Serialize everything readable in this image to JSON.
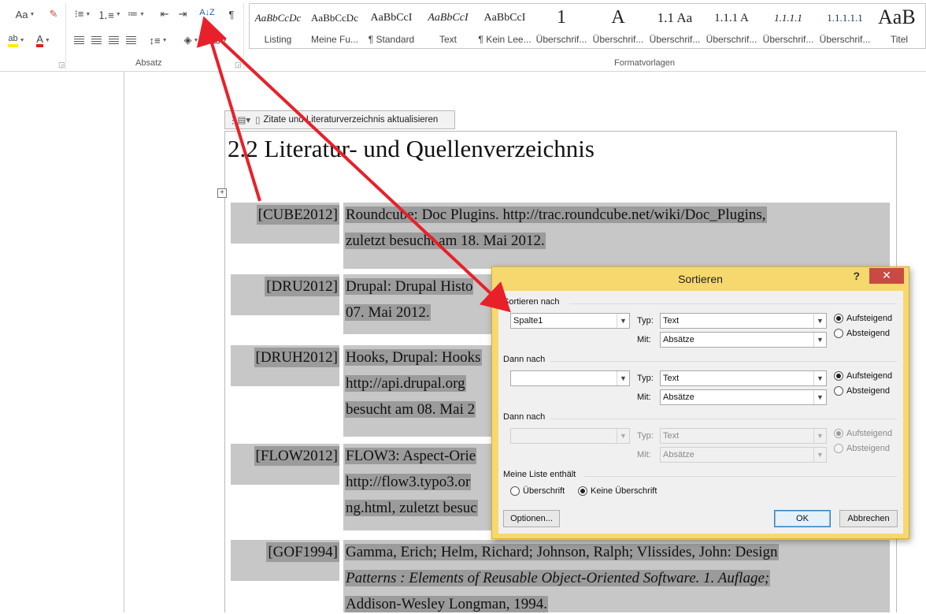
{
  "ribbon": {
    "font_size_button": "Aa",
    "sort_button_glyph": "A↓Z",
    "paragraph_marks_glyph": "¶",
    "group_paragraph_label": "Absatz",
    "group_styles_label": "Formatvorlagen",
    "styles": [
      {
        "sample": "AaBbCcDc",
        "name": "Listing"
      },
      {
        "sample": "AaBbCcDc",
        "name": "Meine Fu..."
      },
      {
        "sample": "AaBbCcI",
        "name": "¶ Standard"
      },
      {
        "sample": "AaBbCcI",
        "name": "Text"
      },
      {
        "sample": "AaBbCcI",
        "name": "¶ Kein Lee..."
      },
      {
        "sample": "1",
        "name": "Überschrif..."
      },
      {
        "sample": "A",
        "name": "Überschrif..."
      },
      {
        "sample": "1.1 Aa",
        "name": "Überschrif..."
      },
      {
        "sample": "1.1.1 A",
        "name": "Überschrif..."
      },
      {
        "sample": "1.1.1.1",
        "name": "Überschrif..."
      },
      {
        "sample": "1.1.1.1.1",
        "name": "Überschrif..."
      },
      {
        "sample": "1.1.1.1.1",
        "name": "Überschrif..."
      },
      {
        "sample": "AaB",
        "name": "Titel"
      }
    ]
  },
  "document": {
    "field_bar_label": "Zitate und Literaturverzeichnis aktualisieren",
    "heading": "2.2 Literatur- und Quellenverzeichnis",
    "references": [
      {
        "key": "[CUBE2012]",
        "lines": [
          "Roundcube: Doc Plugins. http://trac.roundcube.net/wiki/Doc_Plugins,",
          "zuletzt besucht am 18. Mai 2012."
        ]
      },
      {
        "key": "[DRU2012]",
        "lines": [
          "Drupal: Drupal Histo",
          "07. Mai 2012."
        ]
      },
      {
        "key": "[DRUH2012]",
        "lines": [
          "Hooks, Drupal: Hooks",
          "http://api.drupal.org",
          "besucht am 08. Mai 2"
        ]
      },
      {
        "key": "[FLOW2012]",
        "lines": [
          "FLOW3: Aspect-Orie",
          "http://flow3.typo3.or",
          "ng.html, zuletzt besuc"
        ]
      },
      {
        "key": "[GOF1994]",
        "lines": [
          "Gamma, Erich; Helm, Richard; Johnson, Ralph; Vlissides, John: Design",
          "Patterns : Elements of Reusable Object-Oriented Software. 1. Auflage;",
          "Addison-Wesley Longman, 1994."
        ]
      }
    ]
  },
  "dialog": {
    "title": "Sortieren",
    "help": "?",
    "close": "✕",
    "section1_title": "Sortieren nach",
    "section2_title": "Dann nach",
    "section3_title": "Dann nach",
    "type_label": "Typ:",
    "with_label": "Mit:",
    "row1": {
      "column": "Spalte1",
      "type": "Text",
      "with": "Absätze"
    },
    "row2": {
      "column": "",
      "type": "Text",
      "with": "Absätze"
    },
    "row3": {
      "column": "",
      "type": "Text",
      "with": "Absätze"
    },
    "ascending": "Aufsteigend",
    "descending": "Absteigend",
    "list_section_title": "Meine Liste enthält",
    "header_row": "Überschrift",
    "no_header_row": "Keine Überschrift",
    "options_button": "Optionen...",
    "ok_button": "OK",
    "cancel_button": "Abbrechen"
  }
}
